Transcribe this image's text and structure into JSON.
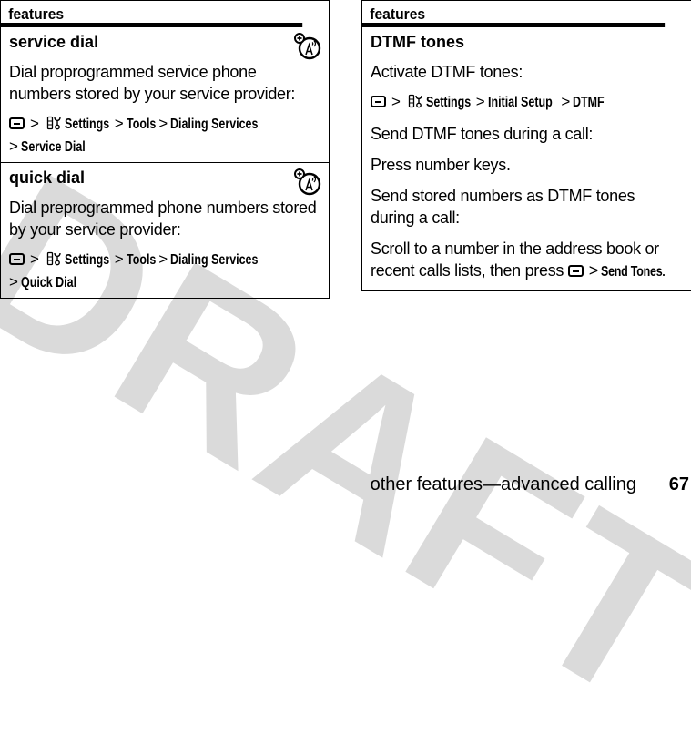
{
  "watermark": "DRAFT",
  "left_table": {
    "header": "features",
    "rows": [
      {
        "title": "service dial",
        "icon": "network-feature-icon",
        "description": "Dial proprogrammed service phone numbers stored by your service provider:",
        "path": {
          "menu_key_icon": "menu-key-icon",
          "settings_icon": "settings-icon",
          "items": [
            "Settings",
            "Tools",
            "Dialing Services",
            "Service Dial"
          ]
        }
      },
      {
        "title": "quick dial",
        "icon": "network-feature-icon",
        "description": "Dial preprogrammed phone numbers stored by your service provider:",
        "path": {
          "menu_key_icon": "menu-key-icon",
          "settings_icon": "settings-icon",
          "items": [
            "Settings",
            "Tools",
            "Dialing Services",
            "Quick Dial"
          ]
        }
      }
    ]
  },
  "right_table": {
    "header": "features",
    "rows": [
      {
        "title": "DTMF tones",
        "activate_label": "Activate DTMF tones:",
        "activate_path": [
          "Settings",
          "Initial Setup",
          "DTMF"
        ],
        "during_call_label": "Send DTMF tones during a call:",
        "during_call_instruction": "Press number keys.",
        "stored_label": "Send stored numbers as DTMF tones during a call:",
        "stored_instruction_prefix": "Scroll to a number in the address book or recent calls lists, then press",
        "stored_instruction_item": "Send Tones",
        "stored_instruction_suffix": "."
      }
    ]
  },
  "footer": {
    "section": "other features—advanced calling",
    "page_number": "67"
  },
  "separator": ">"
}
